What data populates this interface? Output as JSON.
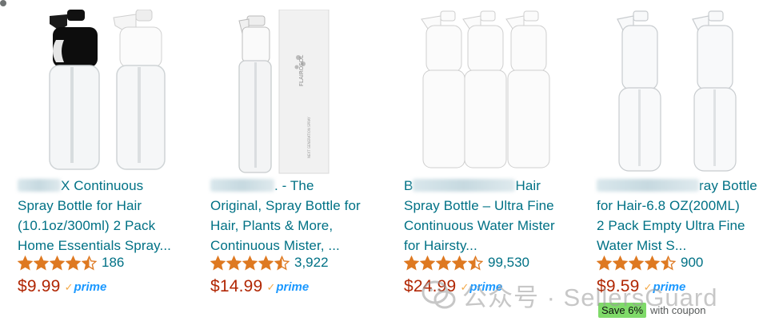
{
  "products": [
    {
      "title_rest": "X Continuous",
      "title_lines": [
        "Spray Bottle for Hair",
        "(10.1oz/300ml) 2 Pack",
        "Home Essentials Spray..."
      ],
      "rating": 4.5,
      "review_count": "186",
      "price": "$9.99",
      "prime": "prime",
      "image": "two-spray-bottles-black-white-icon"
    },
    {
      "title_rest": ". - The",
      "title_lines": [
        "Original, Spray Bottle for",
        "Plants & More,",
        "Continuous Mister, ..."
      ],
      "title_line2_prefix": "Hair, ",
      "rating": 4.5,
      "review_count": "3,922",
      "price": "$14.99",
      "prime": "prime",
      "box_brand": "FLAIROSOL",
      "box_caption": "NEXT GENERATION SPRAY",
      "image": "spray-bottle-with-box-icon"
    },
    {
      "title_rest": "Hair",
      "title_lines": [
        "Spray Bottle – Ultra Fine",
        "Continuous Water Mister",
        "for Hairsty..."
      ],
      "title_prefix": "B",
      "rating": 4.5,
      "review_count": "99,530",
      "price": "$24.99",
      "prime": "prime",
      "image": "three-white-spray-bottles-icon"
    },
    {
      "title_rest": "ray Bottle",
      "title_lines": [
        "for Hair-6.8 OZ(200ML)",
        "2 Pack Empty Ultra Fine",
        "Water Mist S..."
      ],
      "rating": 4.5,
      "review_count": "900",
      "price": "$9.59",
      "prime": "prime",
      "coupon_badge": "Save 6%",
      "coupon_text": "with coupon",
      "image": "two-clear-spray-bottles-icon"
    }
  ],
  "watermark": {
    "text": "公众号 · SellersGuard"
  },
  "colors": {
    "link": "#007185",
    "price": "#b12704",
    "star": "#de7921",
    "prime_blue": "#1a98ff",
    "prime_check": "#f3a847",
    "coupon_bg": "#7fda69"
  }
}
